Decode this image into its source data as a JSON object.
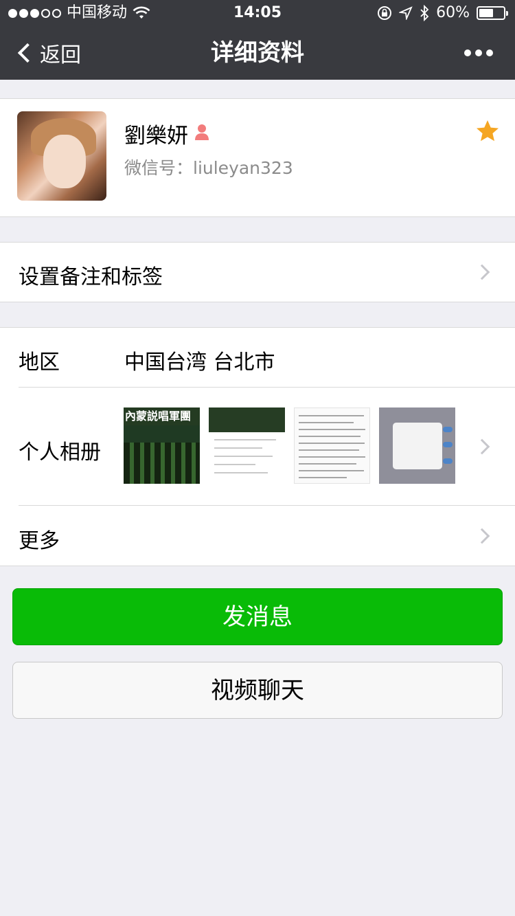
{
  "status_bar": {
    "carrier": "中国移动",
    "time": "14:05",
    "battery": "60%",
    "battery_level": 0.6
  },
  "nav": {
    "back_label": "返回",
    "title": "详细资料"
  },
  "profile": {
    "name": "劉樂妍",
    "wechat_id": "微信号：liuleyan323",
    "starred": true
  },
  "sections": {
    "remark_label": "设置备注和标签",
    "region_label": "地区",
    "region_value": "中国台湾 台北市",
    "album_label": "个人相册",
    "album_thumb1_title": "內蒙説唱軍團",
    "more_label": "更多"
  },
  "actions": {
    "send_message": "发消息",
    "video_chat": "视频聊天"
  },
  "colors": {
    "nav_bg": "#393a3f",
    "primary_green": "#09bb07",
    "star": "#f5a623"
  }
}
